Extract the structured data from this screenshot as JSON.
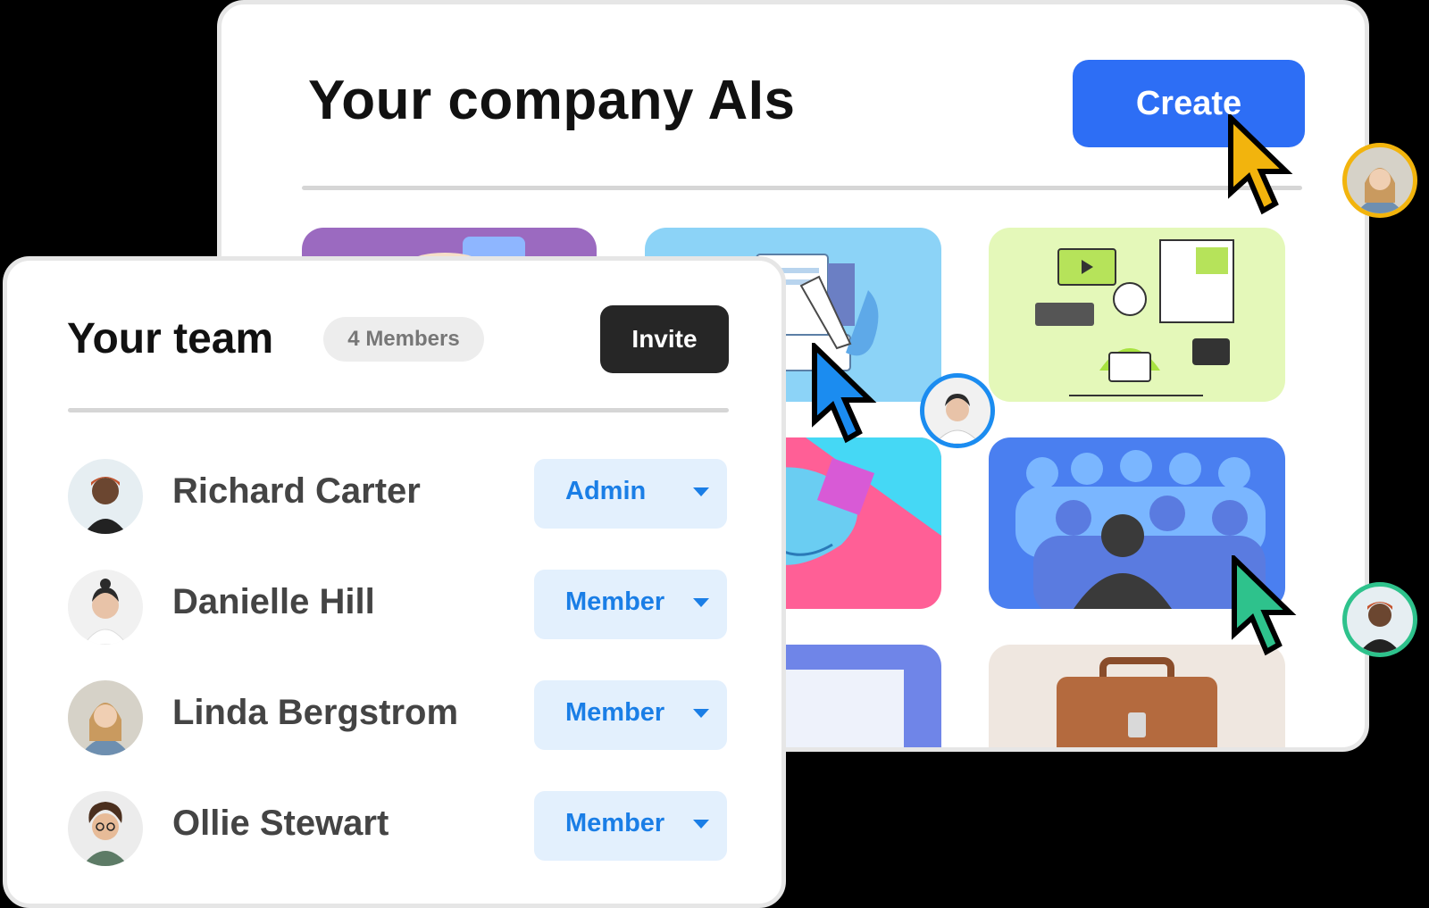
{
  "ai_panel": {
    "title": "Your company AIs",
    "create_label": "Create"
  },
  "team_panel": {
    "title": "Your team",
    "members_badge": "4 Members",
    "invite_label": "Invite",
    "members": [
      {
        "name": "Richard Carter",
        "role": "Admin"
      },
      {
        "name": "Danielle Hill",
        "role": "Member"
      },
      {
        "name": "Linda Bergstrom",
        "role": "Member"
      },
      {
        "name": "Ollie Stewart",
        "role": "Member"
      }
    ]
  },
  "colors": {
    "primary_blue": "#2d6ef5",
    "invite_dark": "#262626",
    "role_bg": "#e3f0fd",
    "role_text": "#1a7ee6",
    "cursor_yellow": "#f2b40d",
    "cursor_blue": "#1b8cf0",
    "cursor_green": "#2ec28c"
  }
}
